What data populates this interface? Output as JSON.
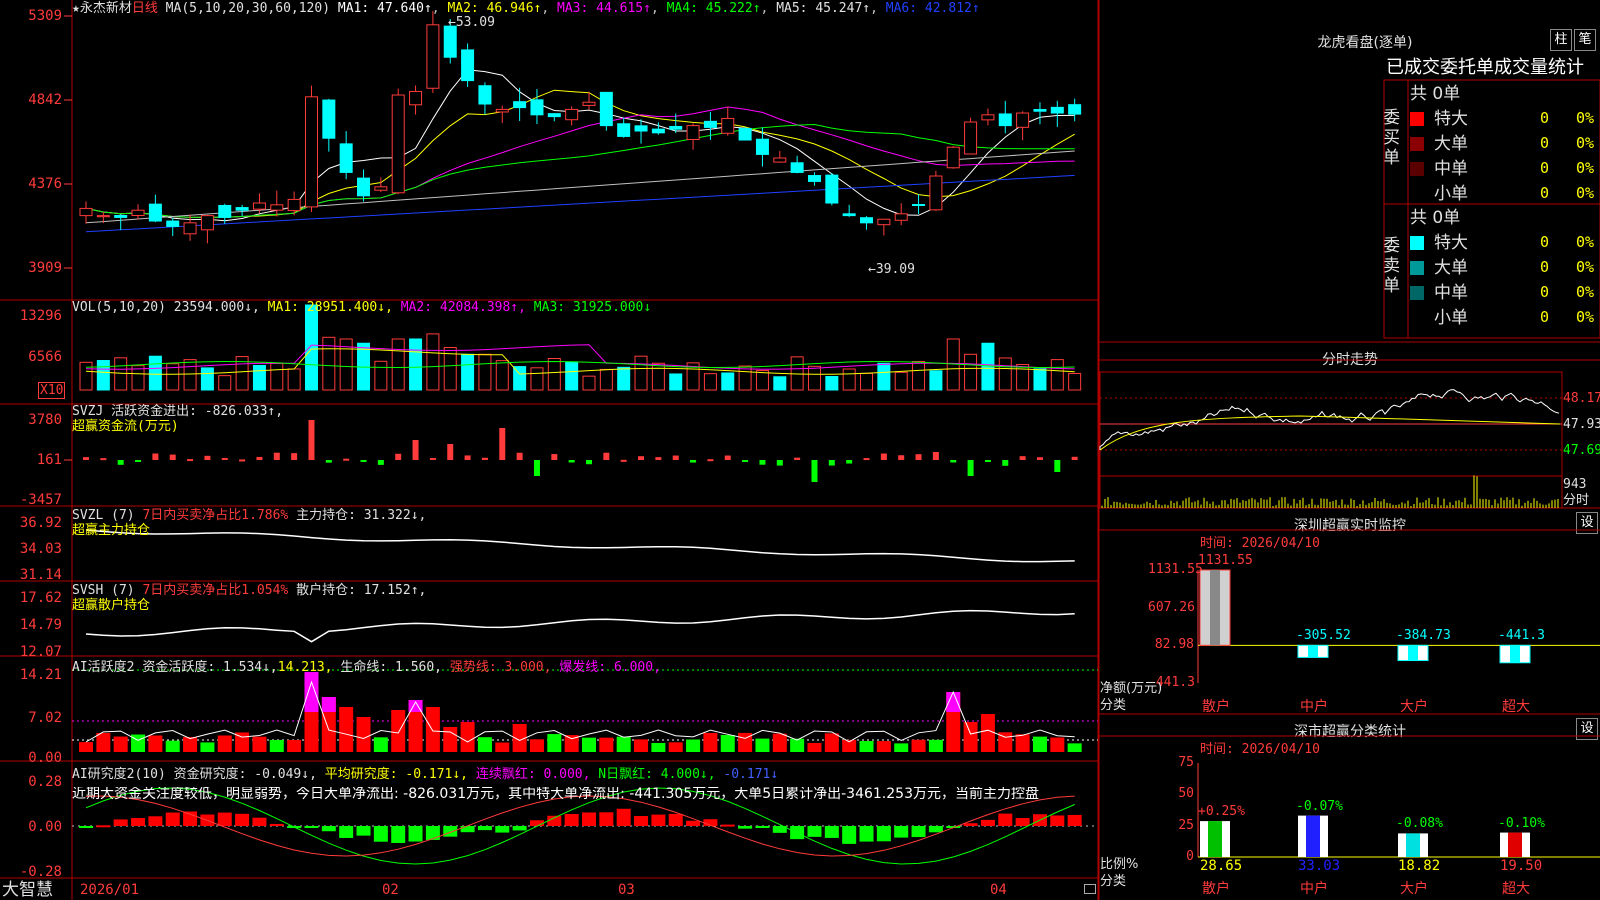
{
  "main": {
    "stock_name": "★永杰新材",
    "period": "日线",
    "ma_params": "MA(5,10,20,30,60,120)",
    "ma_values": [
      {
        "label": "MA1: 47.640↑",
        "color": "#ffffff"
      },
      {
        "label": "MA2: 46.946↑",
        "color": "#ffff00"
      },
      {
        "label": "MA3: 44.615↑",
        "color": "#ff00ff"
      },
      {
        "label": "MA4: 45.222↑",
        "color": "#00ff00"
      },
      {
        "label": "MA5: 45.247↑",
        "color": "#c0c0c0"
      },
      {
        "label": "MA6: 42.812↑",
        "color": "#0000ff"
      }
    ],
    "price_ticks": [
      "5309",
      "4842",
      "4376",
      "3909"
    ],
    "high_label": "53.09",
    "low_label": "39.09"
  },
  "vol": {
    "header": "VOL(5,10,20)",
    "value": "23594.000↓,",
    "ma1": "MA1: 28951.400↓,",
    "ma2": "MA2: 42084.398↑,",
    "ma3": "MA3: 31925.000↓",
    "ticks": [
      "13296",
      "6566"
    ],
    "multiplier": "X10"
  },
  "svzj": {
    "header": "SVZJ  活跃资金进出: -826.033↑,",
    "sub": "超赢资金流(万元)",
    "ticks": [
      "3780",
      "161",
      "-3457"
    ]
  },
  "svzl": {
    "header": "SVZL (7)",
    "ratio": "7日内买卖净占比1.786%",
    "hold": "主力持仓: 31.322↓,",
    "sub": "超赢主力持仓",
    "ticks": [
      "36.92",
      "34.03",
      "31.14"
    ]
  },
  "svsh": {
    "header": "SVSH (7)",
    "ratio": "7日内买卖净占比1.054%",
    "hold": "散户持仓: 17.152↑,",
    "sub": "超赢散户持仓",
    "ticks": [
      "17.62",
      "14.79",
      "12.07"
    ]
  },
  "ai_act": {
    "header": "AI活跃度2",
    "v1": "资金活跃度: 1.534↓,",
    "v2": "14.213,",
    "v3": "生命线: 1.560,",
    "v4": "强势线: 3.000,",
    "v5": "爆发线: 6.000,",
    "ticks": [
      "14.21",
      "7.02",
      "0.00"
    ]
  },
  "ai_res": {
    "header": "AI研究度2(10)",
    "v1": "资金研究度: -0.049↓,",
    "v2": "平均研究度: -0.171↓,",
    "v3": "连续飘红: 0.000,",
    "v4": "N日飘红: 4.000↓,",
    "v5": "-0.171↓",
    "comment": "近期大资金关注度较低，明显弱势，今日大单净流出: -826.031万元，其中特大单净流出: -441.305万元，大单5日累计净出-3461.253万元，当前主力控盘",
    "ticks": [
      "0.28",
      "0.00",
      "-0.28"
    ]
  },
  "footer": {
    "brand": "大智慧",
    "dates": [
      "2026/01",
      "02",
      "03",
      "04"
    ]
  },
  "lhb": {
    "title": "龙虎看盘(逐单)",
    "btn1": "柱",
    "btn2": "笔",
    "sub_title": "已成交委托单成交量统计",
    "buy_label": "委买单",
    "sell_label": "委卖单",
    "buy_total": "共 0单",
    "sell_total": "共 0单",
    "buy_rows": [
      {
        "name": "特大",
        "count": "0",
        "pct": "0%",
        "color": "#ff0000"
      },
      {
        "name": "大单",
        "count": "0",
        "pct": "0%",
        "color": "#8b0000"
      },
      {
        "name": "中单",
        "count": "0",
        "pct": "0%",
        "color": "#5a0000"
      },
      {
        "name": "小单",
        "count": "0",
        "pct": "0%",
        "color": "#000000"
      }
    ],
    "sell_rows": [
      {
        "name": "特大",
        "count": "0",
        "pct": "0%",
        "color": "#00ffff"
      },
      {
        "name": "大单",
        "count": "0",
        "pct": "0%",
        "color": "#009999"
      },
      {
        "name": "中单",
        "count": "0",
        "pct": "0%",
        "color": "#006666"
      },
      {
        "name": "小单",
        "count": "0",
        "pct": "0%",
        "color": "#000000"
      }
    ]
  },
  "fenshi": {
    "title": "分时走势",
    "ticks": [
      "48.17",
      "47.93",
      "47.69"
    ],
    "vol_tick": "943",
    "vol_label": "分时"
  },
  "szmon": {
    "title": "深圳超赢实时监控",
    "btn": "设",
    "time": "时间: 2026/04/10",
    "ylabel": "净额(万元)",
    "xlabel": "分类",
    "ticks": [
      "1131.55",
      "607.26",
      "82.98",
      "-441.3"
    ]
  },
  "szcls": {
    "title": "深市超赢分类统计",
    "btn": "设",
    "time": "时间: 2026/04/10",
    "ylabel": "比例%",
    "xlabel": "分类",
    "ticks": [
      "75",
      "50",
      "25",
      "0"
    ]
  },
  "chart_data": [
    {
      "type": "bar",
      "title": "深圳超赢实时监控",
      "ylabel": "净额(万元)",
      "xlabel": "分类",
      "categories": [
        "散户",
        "中户",
        "大户",
        "超大"
      ],
      "values": [
        1131.55,
        -305.52,
        -384.73,
        -441.3
      ],
      "value_labels": [
        "1131.55",
        "-305.52",
        "-384.73",
        "-441.3"
      ],
      "ylim": [
        -441.3,
        1131.55
      ],
      "ticks": [
        "1131.55",
        "607.26",
        "82.98",
        "-441.3"
      ]
    },
    {
      "type": "bar",
      "title": "深市超赢分类统计",
      "ylabel": "比例%",
      "xlabel": "分类",
      "categories": [
        "散户",
        "中户",
        "大户",
        "超大"
      ],
      "values": [
        28.65,
        33.03,
        18.82,
        19.5
      ],
      "value_labels": [
        "28.65",
        "33.03",
        "18.82",
        "19.50"
      ],
      "changes": [
        "+0.25%",
        "-0.07%",
        "-0.08%",
        "-0.10%"
      ],
      "colors": [
        "#00c000",
        "#2020ff",
        "#00e0e0",
        "#e00000"
      ],
      "ylim": [
        0,
        75
      ],
      "ticks": [
        "75",
        "50",
        "25",
        "0"
      ]
    }
  ]
}
